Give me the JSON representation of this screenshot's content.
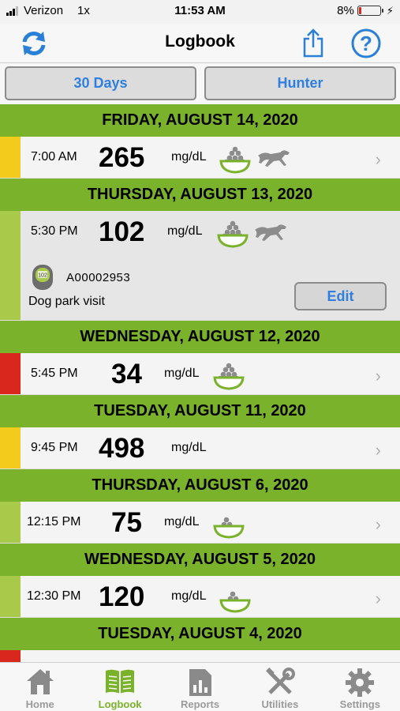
{
  "status_bar": {
    "carrier": "Verizon",
    "network": "1x",
    "time": "11:53 AM",
    "battery": "8%"
  },
  "nav": {
    "title": "Logbook",
    "left_icon": "sync-icon",
    "share_icon": "share-icon",
    "help_icon": "help-icon"
  },
  "segments": {
    "range_label": "30 Days",
    "pet_label": "Hunter"
  },
  "days": [
    {
      "date": "FRIDAY, AUGUST 14, 2020",
      "entries": [
        {
          "time": "7:00 AM",
          "value": "265",
          "unit": "mg/dL",
          "level_color": "#f2cb1d",
          "food": "full",
          "exercise": true
        }
      ]
    },
    {
      "date": "THURSDAY, AUGUST 13, 2020",
      "entries": [
        {
          "time": "5:30 PM",
          "value": "102",
          "unit": "mg/dL",
          "level_color": "#a8c94a",
          "food": "full",
          "exercise": true,
          "expanded": true,
          "meter_display": "102",
          "meter_code": "A00002953",
          "note": "Dog park visit",
          "edit_label": "Edit"
        }
      ]
    },
    {
      "date": "WEDNESDAY, AUGUST 12, 2020",
      "entries": [
        {
          "time": "5:45 PM",
          "value": "34",
          "unit": "mg/dL",
          "level_color": "#d9271e",
          "food": "full",
          "exercise": false
        }
      ]
    },
    {
      "date": "TUESDAY, AUGUST 11, 2020",
      "entries": [
        {
          "time": "9:45 PM",
          "value": "498",
          "unit": "mg/dL",
          "level_color": "#f2cb1d",
          "food": "none",
          "exercise": false
        }
      ]
    },
    {
      "date": "THURSDAY, AUGUST 6, 2020",
      "entries": [
        {
          "time": "12:15 PM",
          "value": "75",
          "unit": "mg/dL",
          "level_color": "#a8c94a",
          "food": "partial",
          "exercise": false
        }
      ]
    },
    {
      "date": "WEDNESDAY, AUGUST 5, 2020",
      "entries": [
        {
          "time": "12:30 PM",
          "value": "120",
          "unit": "mg/dL",
          "level_color": "#a8c94a",
          "food": "partial",
          "exercise": false
        }
      ]
    },
    {
      "date": "TUESDAY, AUGUST 4, 2020",
      "entries": [
        {
          "time": "",
          "value": "",
          "unit": "",
          "level_color": "#d9271e",
          "food": "none",
          "exercise": false
        }
      ]
    }
  ],
  "tabs": [
    {
      "label": "Home",
      "icon": "home-icon",
      "active": false
    },
    {
      "label": "Logbook",
      "icon": "logbook-icon",
      "active": true
    },
    {
      "label": "Reports",
      "icon": "reports-icon",
      "active": false
    },
    {
      "label": "Utilities",
      "icon": "utilities-icon",
      "active": false
    },
    {
      "label": "Settings",
      "icon": "settings-icon",
      "active": false
    }
  ],
  "colors": {
    "accent_green": "#7ab22b",
    "link_blue": "#2f7fe0",
    "high_yellow": "#f2cb1d",
    "normal_green": "#a8c94a",
    "low_red": "#d9271e"
  }
}
